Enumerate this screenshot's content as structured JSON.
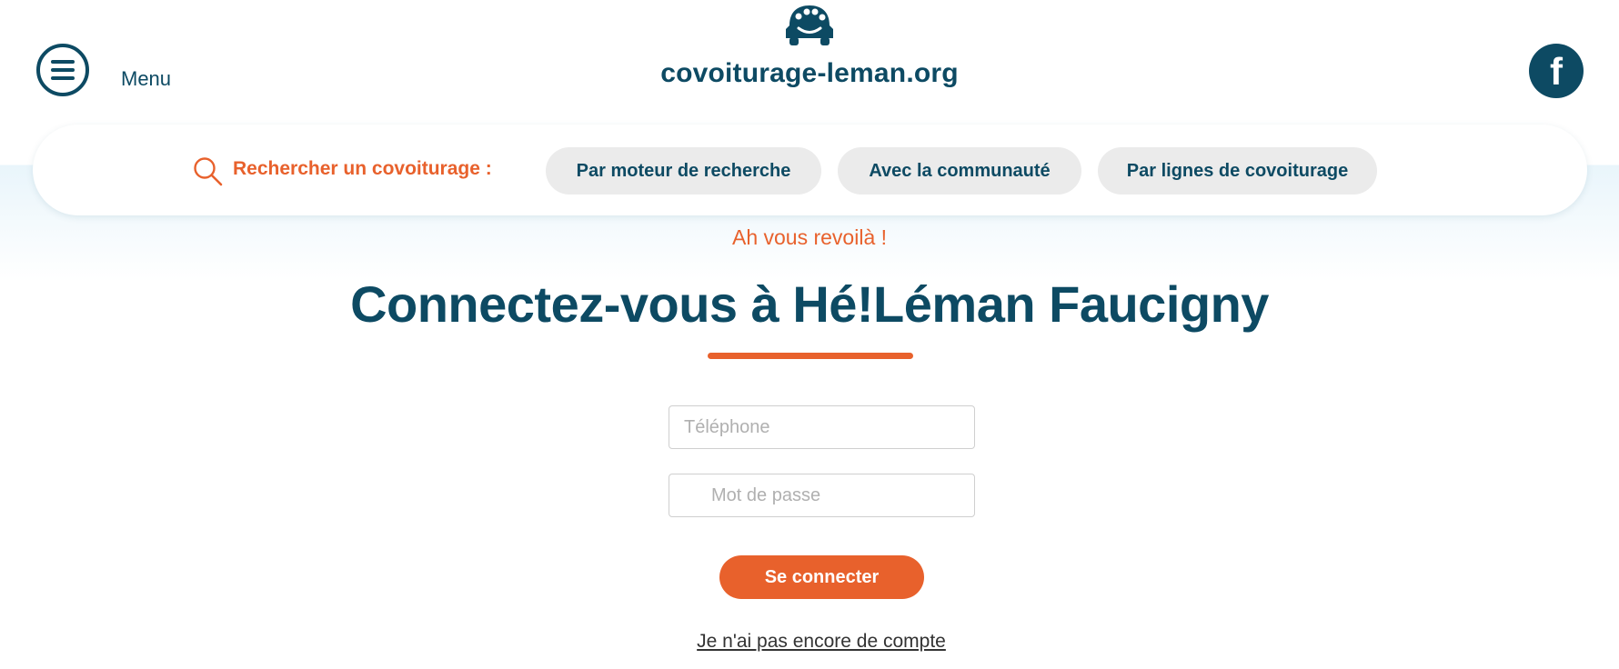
{
  "header": {
    "menu_label": "Menu",
    "site_name": "covoiturage-leman.org",
    "facebook_glyph": "f"
  },
  "search_bar": {
    "label": "Rechercher un covoiturage :",
    "options": [
      "Par moteur de recherche",
      "Avec la communauté",
      "Par lignes de covoiturage"
    ]
  },
  "login": {
    "greeting": "Ah vous revoilà !",
    "title": "Connectez-vous à Hé!Léman Faucigny",
    "phone_placeholder": "Téléphone",
    "password_placeholder": "Mot de passe",
    "submit_label": "Se connecter",
    "signup_link": "Je n'ai pas encore de compte"
  },
  "colors": {
    "primary": "#0d4a63",
    "accent": "#e8612c",
    "pill_background": "#ebebeb",
    "band_background": "#e9f5fb"
  },
  "icons": {
    "menu": "hamburger-icon",
    "logo": "car-smile-logo",
    "facebook": "facebook-icon",
    "search": "search-icon"
  }
}
